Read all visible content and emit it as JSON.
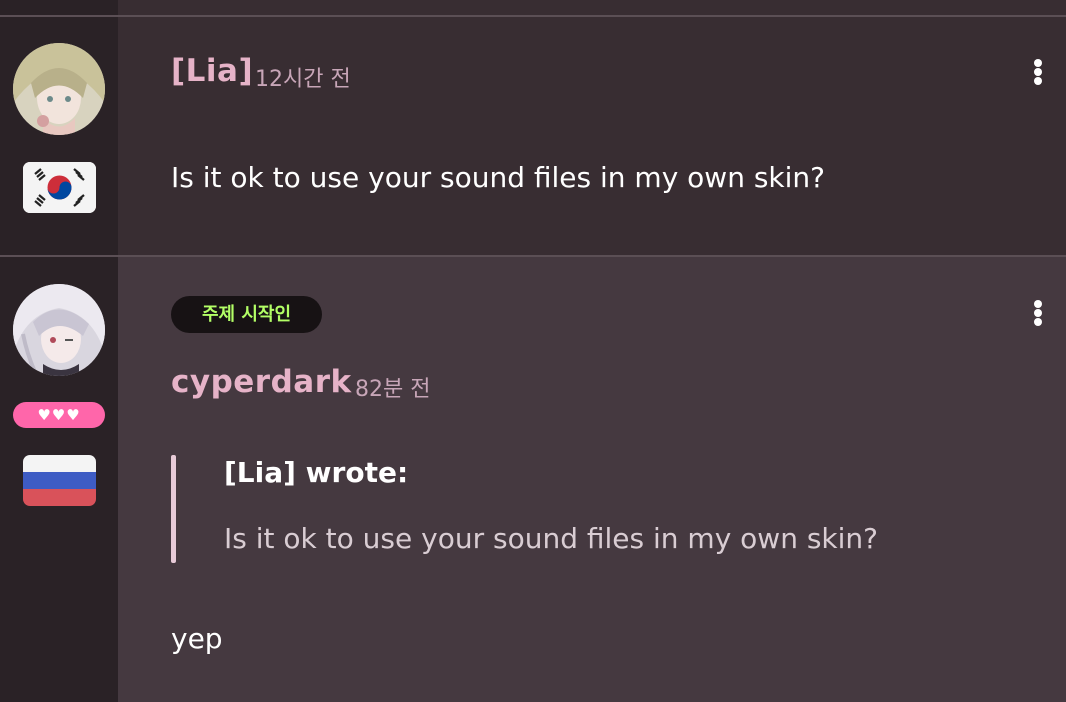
{
  "posts": [
    {
      "username": "[Lia]",
      "time": "12시간 전",
      "text": "Is it ok to use your sound files in my own skin?",
      "country_flag": "south-korea-flag-icon"
    },
    {
      "username": "cyperdark",
      "time": "82분 전",
      "tag": "주제 시작인",
      "badge": "♥♥♥",
      "quote": {
        "author": "[Lia] wrote:",
        "text": "Is it ok to use your sound files in my own skin?"
      },
      "reply": "yep",
      "country_flag": "russia-flag-icon"
    }
  ],
  "colors": {
    "sidebar_bg": "#2a2226",
    "post1_bg": "#382d32",
    "post2_bg": "#453940",
    "username": "#e6b3c8",
    "tag_text": "#b3ff66",
    "supporter_badge": "#ff66aa"
  }
}
